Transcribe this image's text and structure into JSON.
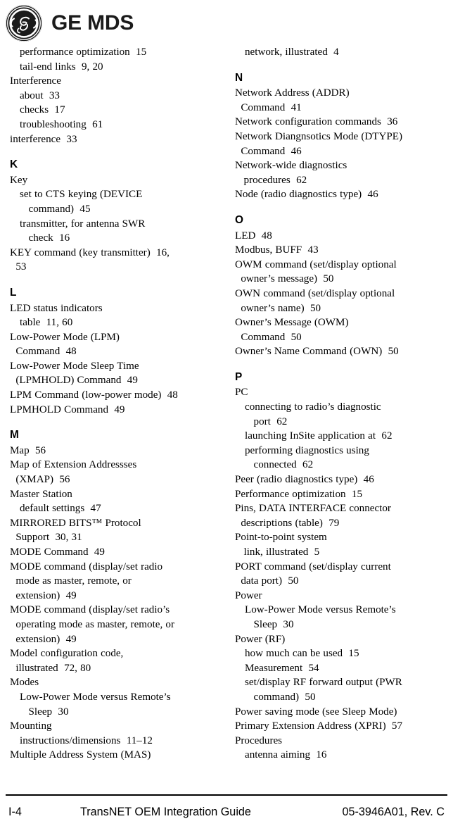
{
  "logo": {
    "monogram_alt": "GE monogram",
    "wordmark": "GE MDS",
    "color": "#1b1b1b"
  },
  "index": {
    "columns": [
      {
        "name": "left",
        "blocks": [
          {
            "type": "entry",
            "level": 1,
            "text": "performance optimization  15"
          },
          {
            "type": "entry",
            "level": 1,
            "text": "tail-end links  9, 20"
          },
          {
            "type": "entry",
            "level": 0,
            "text": "Interference"
          },
          {
            "type": "entry",
            "level": 1,
            "text": "about  33"
          },
          {
            "type": "entry",
            "level": 1,
            "text": "checks  17"
          },
          {
            "type": "entry",
            "level": 1,
            "text": "troubleshooting  61"
          },
          {
            "type": "entry",
            "level": 0,
            "text": "interference  33"
          },
          {
            "type": "letter",
            "text": "K"
          },
          {
            "type": "entry",
            "level": 0,
            "text": "Key"
          },
          {
            "type": "entry",
            "level": 1,
            "text": "set to CTS keying (DEVICE\n   command)  45"
          },
          {
            "type": "entry",
            "level": 1,
            "text": "transmitter, for antenna SWR\n   check  16"
          },
          {
            "type": "entry",
            "level": 0,
            "text": "KEY command (key transmitter)  16,\n  53"
          },
          {
            "type": "letter",
            "text": "L"
          },
          {
            "type": "entry",
            "level": 0,
            "text": "LED status indicators"
          },
          {
            "type": "entry",
            "level": 1,
            "text": "table  11, 60"
          },
          {
            "type": "entry",
            "level": 0,
            "text": "Low-Power Mode (LPM)\n  Command  48"
          },
          {
            "type": "entry",
            "level": 0,
            "text": "Low-Power Mode Sleep Time\n  (LPMHOLD) Command  49"
          },
          {
            "type": "entry",
            "level": 0,
            "text": "LPM Command (low-power mode)  48"
          },
          {
            "type": "entry",
            "level": 0,
            "text": "LPMHOLD Command  49"
          },
          {
            "type": "letter",
            "text": "M"
          },
          {
            "type": "entry",
            "level": 0,
            "text": "Map  56"
          },
          {
            "type": "entry",
            "level": 0,
            "text": "Map of Extension Addressses\n  (XMAP)  56"
          },
          {
            "type": "entry",
            "level": 0,
            "text": "Master Station"
          },
          {
            "type": "entry",
            "level": 1,
            "text": "default settings  47"
          },
          {
            "type": "entry",
            "level": 0,
            "text": "MIRRORED BITS™ Protocol\n  Support  30, 31"
          },
          {
            "type": "entry",
            "level": 0,
            "text": "MODE Command  49"
          },
          {
            "type": "entry",
            "level": 0,
            "text": "MODE command (display/set radio\n  mode as master, remote, or\n  extension)  49"
          },
          {
            "type": "entry",
            "level": 0,
            "text": "MODE command (display/set radio’s\n  operating mode as master, remote, or\n  extension)  49"
          },
          {
            "type": "entry",
            "level": 0,
            "text": "Model configuration code,\n  illustrated  72, 80"
          },
          {
            "type": "entry",
            "level": 0,
            "text": "Modes"
          },
          {
            "type": "entry",
            "level": 1,
            "text": "Low-Power Mode versus Remote’s\n   Sleep  30"
          },
          {
            "type": "entry",
            "level": 0,
            "text": "Mounting"
          },
          {
            "type": "entry",
            "level": 1,
            "text": "instructions/dimensions  11–12"
          },
          {
            "type": "entry",
            "level": 0,
            "text": "Multiple Address System (MAS)"
          }
        ]
      },
      {
        "name": "right",
        "blocks": [
          {
            "type": "entry",
            "level": 1,
            "text": "network, illustrated  4"
          },
          {
            "type": "letter",
            "text": "N"
          },
          {
            "type": "entry",
            "level": 0,
            "text": "Network Address (ADDR)\n  Command  41"
          },
          {
            "type": "entry",
            "level": 0,
            "text": "Network configuration commands  36"
          },
          {
            "type": "entry",
            "level": 0,
            "text": "Network Diangnsotics Mode (DTYPE)\n  Command  46"
          },
          {
            "type": "entry",
            "level": 0,
            "text": "Network-wide diagnostics\n   procedures  62"
          },
          {
            "type": "entry",
            "level": 0,
            "text": "Node (radio diagnostics type)  46"
          },
          {
            "type": "letter",
            "text": "O"
          },
          {
            "type": "entry",
            "level": 0,
            "text": "LED  48"
          },
          {
            "type": "entry",
            "level": 0,
            "text": "Modbus, BUFF  43"
          },
          {
            "type": "entry",
            "level": 0,
            "text": "OWM command (set/display optional\n  owner’s message)  50"
          },
          {
            "type": "entry",
            "level": 0,
            "text": "OWN command (set/display optional\n  owner’s name)  50"
          },
          {
            "type": "entry",
            "level": 0,
            "text": "Owner’s Message (OWM)\n  Command  50"
          },
          {
            "type": "entry",
            "level": 0,
            "text": "Owner’s Name Command (OWN)  50"
          },
          {
            "type": "letter",
            "text": "P"
          },
          {
            "type": "entry",
            "level": 0,
            "text": "PC"
          },
          {
            "type": "entry",
            "level": 1,
            "text": "connecting to radio’s diagnostic\n   port  62"
          },
          {
            "type": "entry",
            "level": 1,
            "text": "launching InSite application at  62"
          },
          {
            "type": "entry",
            "level": 1,
            "text": "performing diagnostics using\n   connected  62"
          },
          {
            "type": "entry",
            "level": 0,
            "text": "Peer (radio diagnostics type)  46"
          },
          {
            "type": "entry",
            "level": 0,
            "text": "Performance optimization  15"
          },
          {
            "type": "entry",
            "level": 0,
            "text": "Pins, DATA INTERFACE connector\n  descriptions (table)  79"
          },
          {
            "type": "entry",
            "level": 0,
            "text": "Point-to-point system\n   link, illustrated  5"
          },
          {
            "type": "entry",
            "level": 0,
            "text": "PORT command (set/display current\n  data port)  50"
          },
          {
            "type": "entry",
            "level": 0,
            "text": "Power"
          },
          {
            "type": "entry",
            "level": 1,
            "text": "Low-Power Mode versus Remote’s\n   Sleep  30"
          },
          {
            "type": "entry",
            "level": 0,
            "text": "Power (RF)"
          },
          {
            "type": "entry",
            "level": 1,
            "text": "how much can be used  15"
          },
          {
            "type": "entry",
            "level": 1,
            "text": "Measurement  54"
          },
          {
            "type": "entry",
            "level": 1,
            "text": "set/display RF forward output (PWR\n   command)  50"
          },
          {
            "type": "entry",
            "level": 0,
            "text": "Power saving mode (see Sleep Mode)"
          },
          {
            "type": "entry",
            "level": 0,
            "text": "Primary Extension Address (XPRI)  57"
          },
          {
            "type": "entry",
            "level": 0,
            "text": "Procedures"
          },
          {
            "type": "entry",
            "level": 1,
            "text": "antenna aiming  16"
          }
        ]
      }
    ]
  },
  "footer": {
    "page_number": "I-4",
    "title": "TransNET OEM Integration Guide",
    "part_number": "05-3946A01, Rev.  C"
  }
}
